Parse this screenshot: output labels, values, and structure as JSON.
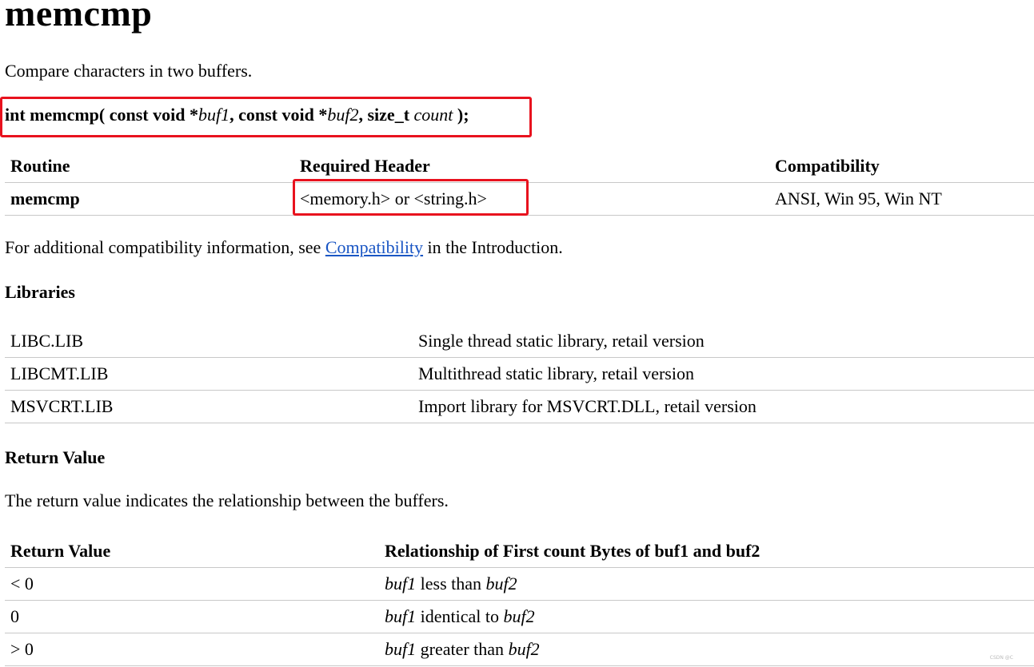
{
  "title": "memcmp",
  "description": "Compare characters in two buffers.",
  "syntax": {
    "p1": "int memcmp( const void *",
    "a1": "buf1",
    "p2": ", const void *",
    "a2": "buf2",
    "p3": ", size_t ",
    "a3": "count",
    "p4": " );"
  },
  "routine_table": {
    "headers": [
      "Routine",
      "Required Header",
      "Compatibility"
    ],
    "rows": [
      [
        "memcmp",
        "<memory.h> or <string.h>",
        "ANSI, Win 95, Win NT"
      ]
    ]
  },
  "compat_note": {
    "before": "For additional compatibility information, see ",
    "link": "Compatibility",
    "after": " in the Introduction."
  },
  "libraries": {
    "heading": "Libraries",
    "rows": [
      [
        "LIBC.LIB",
        "Single thread static library, retail version"
      ],
      [
        "LIBCMT.LIB",
        "Multithread static library, retail version"
      ],
      [
        "MSVCRT.LIB",
        "Import library for MSVCRT.DLL, retail version"
      ]
    ]
  },
  "return_value": {
    "heading": "Return Value",
    "text": "The return value indicates the relationship between the buffers.",
    "headers": [
      "Return Value",
      "Relationship of First count Bytes of buf1 and buf2"
    ],
    "rows": [
      {
        "value": "< 0",
        "a": "buf1",
        "rel": " less than ",
        "b": "buf2"
      },
      {
        "value": "0",
        "a": "buf1",
        "rel": " identical to ",
        "b": "buf2"
      },
      {
        "value": "> 0",
        "a": "buf1",
        "rel": " greater than ",
        "b": "buf2"
      }
    ]
  },
  "watermark": "CSDN @C",
  "colors": {
    "highlight_box": "#e8121e",
    "link": "#1a56c4",
    "rule": "#c8c8c8"
  }
}
